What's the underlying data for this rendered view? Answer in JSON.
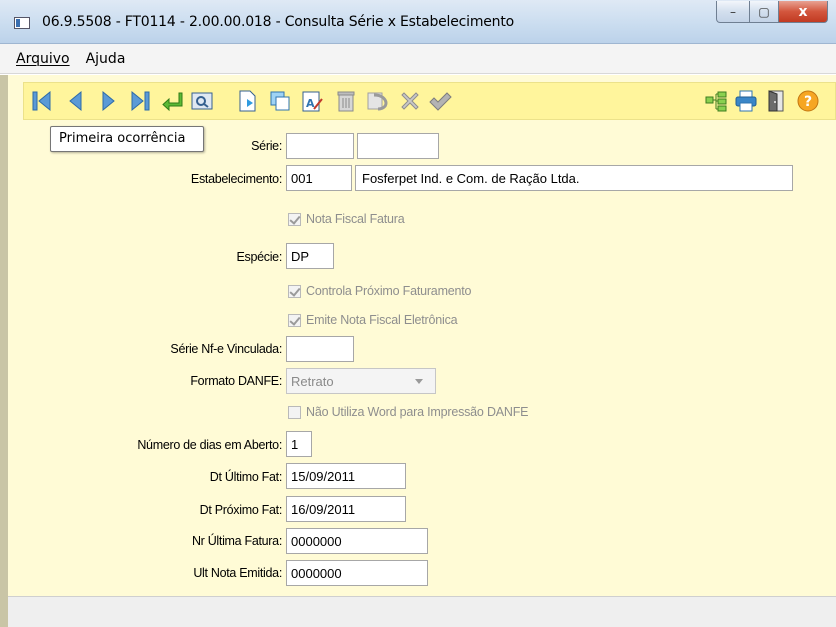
{
  "window": {
    "title": "06.9.5508 - FT0114 - 2.00.00.018 - Consulta Série x Estabelecimento",
    "min_glyph": "–",
    "max_glyph": "▢",
    "close_glyph": "x"
  },
  "menu": {
    "items": [
      {
        "label": "Arquivo"
      },
      {
        "label": "Ajuda"
      }
    ]
  },
  "toolbar": {
    "icons": [
      "first-record-icon",
      "previous-record-icon",
      "next-record-icon",
      "last-record-icon",
      "goto-icon",
      "search-icon",
      "new-icon",
      "copy-icon",
      "edit-icon",
      "delete-icon",
      "undo-icon",
      "cancel-icon",
      "save-icon",
      "tree-icon",
      "print-icon",
      "exit-icon",
      "help-icon"
    ],
    "tooltip": "Primeira ocorrência"
  },
  "form": {
    "serie_label": "Série:",
    "serie_value": "",
    "serie_desc": "",
    "estabelecimento_label": "Estabelecimento:",
    "estabelecimento_code": "001",
    "estabelecimento_name": "Fosferpet Ind. e Com. de Ração Ltda.",
    "nota_fiscal_fatura": "Nota Fiscal Fatura",
    "especie_label": "Espécie:",
    "especie_value": "DP",
    "controla_proximo": "Controla Próximo Faturamento",
    "emite_nfe": "Emite Nota Fiscal Eletrônica",
    "serie_nfe_label": "Série Nf-e Vinculada:",
    "serie_nfe_value": "",
    "formato_danfe_label": "Formato DANFE:",
    "formato_danfe_value": "Retrato",
    "nao_utiliza_word": "Não Utiliza Word para Impressão DANFE",
    "dias_aberto_label": "Número de dias em Aberto:",
    "dias_aberto_value": "1",
    "dt_ultimo_label": "Dt Último Fat:",
    "dt_ultimo_value": "15/09/2011",
    "dt_proximo_label": "Dt Próximo Fat:",
    "dt_proximo_value": "16/09/2011",
    "nr_ultima_label": "Nr Última Fatura:",
    "nr_ultima_value": "0000000",
    "ult_nota_label": "Ult Nota Emitida:",
    "ult_nota_value": "0000000"
  }
}
